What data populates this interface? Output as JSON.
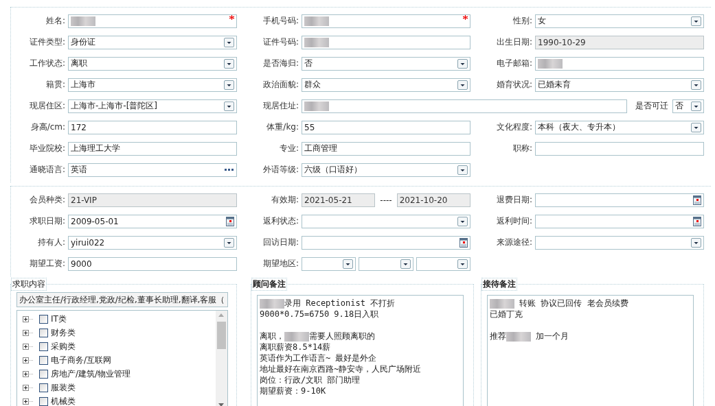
{
  "sections": [
    {
      "rows": [
        [
          {
            "label": "姓名:",
            "controls": [
              {
                "kind": "text",
                "redacted": true,
                "required": true
              }
            ]
          },
          {
            "label": "手机号码:",
            "controls": [
              {
                "kind": "text",
                "redacted": true,
                "required": true
              }
            ]
          },
          {
            "label": "性别:",
            "controls": [
              {
                "kind": "select",
                "value": "女"
              }
            ]
          }
        ],
        [
          {
            "label": "证件类型:",
            "controls": [
              {
                "kind": "select",
                "value": "身份证"
              }
            ]
          },
          {
            "label": "证件号码:",
            "controls": [
              {
                "kind": "text",
                "redacted": true
              }
            ]
          },
          {
            "label": "出生日期:",
            "controls": [
              {
                "kind": "text",
                "value": "1990-10-29",
                "readonly": true
              }
            ]
          }
        ],
        [
          {
            "label": "工作状态:",
            "controls": [
              {
                "kind": "select",
                "value": "离职"
              }
            ]
          },
          {
            "label": "是否海归:",
            "controls": [
              {
                "kind": "select",
                "value": "否"
              }
            ]
          },
          {
            "label": "电子邮箱:",
            "controls": [
              {
                "kind": "text",
                "redacted": true
              }
            ]
          }
        ],
        [
          {
            "label": "籍贯:",
            "controls": [
              {
                "kind": "select",
                "value": "上海市"
              }
            ]
          },
          {
            "label": "政治面貌:",
            "controls": [
              {
                "kind": "select",
                "value": "群众"
              }
            ]
          },
          {
            "label": "婚育状况:",
            "controls": [
              {
                "kind": "select",
                "value": "已婚未育"
              }
            ]
          }
        ],
        [
          {
            "label": "现居住区:",
            "controls": [
              {
                "kind": "select",
                "value": "上海市-上海市-[普陀区]"
              }
            ]
          },
          {
            "label": "现居住址:",
            "wide": true,
            "controls": [
              {
                "kind": "text",
                "redacted": true
              },
              {
                "kind": "label",
                "value": "是否可迁"
              },
              {
                "kind": "select",
                "value": "否"
              }
            ]
          }
        ],
        [
          {
            "label": "身高/cm:",
            "controls": [
              {
                "kind": "text",
                "value": "172"
              }
            ]
          },
          {
            "label": "体重/kg:",
            "controls": [
              {
                "kind": "text",
                "value": "55"
              }
            ]
          },
          {
            "label": "文化程度:",
            "controls": [
              {
                "kind": "select",
                "value": "本科（夜大、专升本）"
              }
            ]
          }
        ],
        [
          {
            "label": "毕业院校:",
            "controls": [
              {
                "kind": "text",
                "value": "上海理工大学"
              }
            ]
          },
          {
            "label": "专业:",
            "controls": [
              {
                "kind": "text",
                "value": "工商管理"
              }
            ]
          },
          {
            "label": "职称:",
            "controls": [
              {
                "kind": "text"
              }
            ]
          }
        ],
        [
          {
            "label": "通晓语言:",
            "controls": [
              {
                "kind": "more",
                "value": "英语"
              }
            ]
          },
          {
            "label": "外语等级:",
            "controls": [
              {
                "kind": "select",
                "value": "六级（口语好）"
              }
            ]
          }
        ]
      ]
    },
    {
      "rows": [
        [
          {
            "label": "会员种类:",
            "controls": [
              {
                "kind": "text",
                "value": "21-VIP",
                "readonly": true
              }
            ]
          },
          {
            "label": "有效期:",
            "controls": [
              {
                "kind": "text",
                "value": "2021-05-21",
                "readonly": true
              },
              {
                "kind": "dash",
                "value": "----"
              },
              {
                "kind": "text",
                "value": "2021-10-20",
                "readonly": true
              }
            ]
          },
          {
            "label": "退费日期:",
            "controls": [
              {
                "kind": "date"
              }
            ]
          }
        ],
        [
          {
            "label": "求职日期:",
            "controls": [
              {
                "kind": "date",
                "value": "2009-05-01"
              }
            ]
          },
          {
            "label": "返利状态:",
            "controls": [
              {
                "kind": "select"
              }
            ]
          },
          {
            "label": "返利时间:",
            "controls": [
              {
                "kind": "date"
              }
            ]
          }
        ],
        [
          {
            "label": "持有人:",
            "controls": [
              {
                "kind": "select",
                "value": "yirui022"
              }
            ]
          },
          {
            "label": "回访日期:",
            "controls": [
              {
                "kind": "date"
              }
            ]
          },
          {
            "label": "来源途径:",
            "controls": [
              {
                "kind": "select"
              }
            ]
          }
        ],
        [
          {
            "label": "期望工资:",
            "controls": [
              {
                "kind": "text",
                "value": "9000"
              }
            ]
          },
          {
            "label": "期望地区:",
            "controls": [
              {
                "kind": "select"
              },
              {
                "kind": "select"
              },
              {
                "kind": "select"
              }
            ]
          }
        ]
      ]
    }
  ],
  "job_panel": {
    "title": "求职内容",
    "summary": "办公室主任/行政经理,党政/纪检,董事长助理,翻译,客服（",
    "tree": [
      {
        "label": "IT类",
        "checked": false,
        "expanded": false
      },
      {
        "label": "财务类",
        "checked": false,
        "expanded": false
      },
      {
        "label": "采购类",
        "checked": false,
        "expanded": false
      },
      {
        "label": "电子商务/互联网",
        "checked": false,
        "expanded": false
      },
      {
        "label": "房地产/建筑/物业管理",
        "checked": false,
        "expanded": false
      },
      {
        "label": "服装类",
        "checked": false,
        "expanded": false
      },
      {
        "label": "机械类",
        "checked": false,
        "expanded": false
      }
    ]
  },
  "notes": [
    {
      "title": "顾问备注",
      "paragraphs": [
        [
          [
            {
              "kind": "redacted"
            },
            {
              "kind": "text",
              "text": "录用 Receptionist 不打折 9000*0.75=6750  9.18日入职"
            }
          ]
        ],
        [
          [
            {
              "kind": "text",
              "text": "离职，"
            },
            {
              "kind": "redacted"
            },
            {
              "kind": "text",
              "text": "需要人照顾离职的"
            }
          ],
          [
            {
              "kind": "text",
              "text": "离职薪资8.5*14薪"
            }
          ],
          [
            {
              "kind": "text",
              "text": "英语作为工作语言~ 最好是外企"
            }
          ],
          [
            {
              "kind": "text",
              "text": "地址最好在南京西路~静安寺，人民广场附近"
            }
          ],
          [
            {
              "kind": "text",
              "text": "岗位：行政/文职 部门助理"
            }
          ],
          [
            {
              "kind": "text",
              "text": "期望薪资：9-10K"
            }
          ]
        ]
      ]
    },
    {
      "title": "接待备注",
      "paragraphs": [
        [
          [
            {
              "kind": "redacted"
            },
            {
              "kind": "text",
              "text": " 转账 协议已回传 老会员续费"
            }
          ],
          [
            {
              "kind": "text",
              "text": "已婚丁克"
            }
          ]
        ],
        [
          [
            {
              "kind": "text",
              "text": "推荐"
            },
            {
              "kind": "redacted"
            },
            {
              "kind": "text",
              "text": " 加一个月"
            }
          ]
        ]
      ]
    }
  ]
}
